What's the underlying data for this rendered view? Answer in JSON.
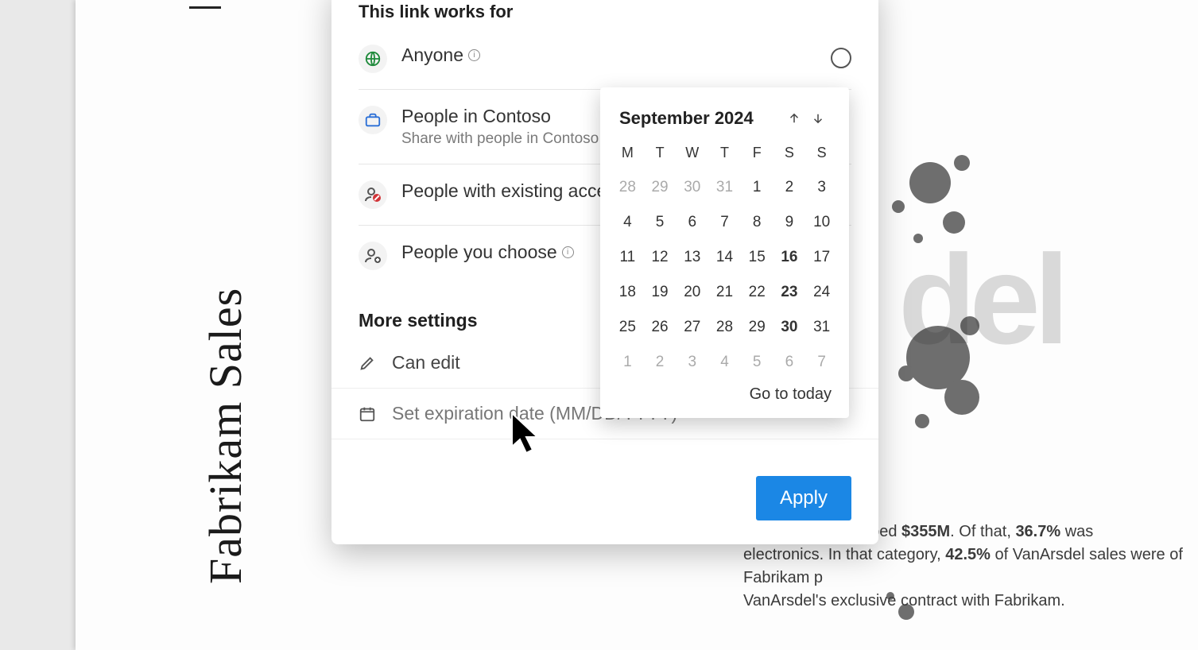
{
  "background": {
    "title": "Fabrikam Sales",
    "watermark": "del",
    "body_line1_prefix": "orldwide sales topped ",
    "body_line1_bold": "$355M",
    "body_line1_mid": ". Of that, ",
    "body_line1_pct": "36.7%",
    "body_line1_suffix": " was",
    "body_line2_prefix": "electronics. In that category, ",
    "body_line2_pct": "42.5%",
    "body_line2_suffix": " of VanArsdel sales were of Fabrikam p",
    "body_line3": "VanArsdel's exclusive contract with Fabrikam."
  },
  "dialog": {
    "section_title": "This link works for",
    "options": [
      {
        "label": "Anyone",
        "sub": "",
        "has_info": true,
        "icon": "globe",
        "radio": true
      },
      {
        "label": "People in Contoso",
        "sub": "Share with people in Contoso, on",
        "has_info": false,
        "icon": "briefcase",
        "radio": false
      },
      {
        "label": "People with existing access",
        "sub": "",
        "has_info": true,
        "icon": "people-block",
        "radio": false
      },
      {
        "label": "People you choose",
        "sub": "",
        "has_info": true,
        "icon": "people-add",
        "radio": false
      }
    ],
    "more_title": "More settings",
    "can_edit": "Can edit",
    "expiration_label": "Set expiration date (MM/DD/YYYY)",
    "apply": "Apply"
  },
  "calendar": {
    "month": "September 2024",
    "day_headers": [
      "M",
      "T",
      "W",
      "T",
      "F",
      "S",
      "S"
    ],
    "weeks": [
      [
        {
          "n": "28",
          "muted": true
        },
        {
          "n": "29",
          "muted": true
        },
        {
          "n": "30",
          "muted": true
        },
        {
          "n": "31",
          "muted": true
        },
        {
          "n": "1"
        },
        {
          "n": "2"
        },
        {
          "n": "3"
        }
      ],
      [
        {
          "n": "4"
        },
        {
          "n": "5"
        },
        {
          "n": "6"
        },
        {
          "n": "7"
        },
        {
          "n": "8"
        },
        {
          "n": "9"
        },
        {
          "n": "10"
        }
      ],
      [
        {
          "n": "11"
        },
        {
          "n": "12"
        },
        {
          "n": "13"
        },
        {
          "n": "14"
        },
        {
          "n": "15"
        },
        {
          "n": "16",
          "bold": true
        },
        {
          "n": "17"
        }
      ],
      [
        {
          "n": "18"
        },
        {
          "n": "19"
        },
        {
          "n": "20"
        },
        {
          "n": "21"
        },
        {
          "n": "22"
        },
        {
          "n": "23",
          "bold": true
        },
        {
          "n": "24"
        }
      ],
      [
        {
          "n": "25"
        },
        {
          "n": "26"
        },
        {
          "n": "27"
        },
        {
          "n": "28"
        },
        {
          "n": "29"
        },
        {
          "n": "30",
          "bold": true
        },
        {
          "n": "31"
        }
      ],
      [
        {
          "n": "1",
          "muted": true
        },
        {
          "n": "2",
          "muted": true
        },
        {
          "n": "3",
          "muted": true
        },
        {
          "n": "4",
          "muted": true
        },
        {
          "n": "5",
          "muted": true
        },
        {
          "n": "6",
          "muted": true
        },
        {
          "n": "7",
          "muted": true
        }
      ]
    ],
    "today": "Go to today"
  }
}
